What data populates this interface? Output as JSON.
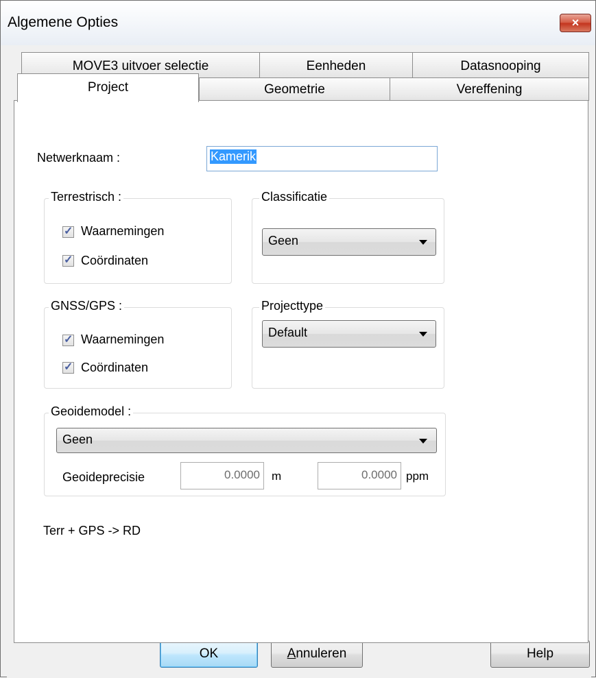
{
  "window": {
    "title": "Algemene Opties",
    "close_glyph": "×",
    "close_icon": "close-icon"
  },
  "tabs": {
    "row1": [
      "MOVE3 uitvoer selectie",
      "Eenheden",
      "Datasnooping"
    ],
    "row2": [
      "Project",
      "Geometrie",
      "Vereffening"
    ],
    "active": "Project"
  },
  "project": {
    "network_name_label": "Netwerknaam :",
    "network_name_value": "Kamerik",
    "terrestrial": {
      "title": "Terrestrisch :",
      "observations": {
        "label": "Waarnemingen",
        "checked": true
      },
      "coordinates": {
        "label": "Coördinaten",
        "checked": true
      }
    },
    "classification": {
      "title": "Classificatie",
      "value": "Geen"
    },
    "gnss": {
      "title": "GNSS/GPS :",
      "observations": {
        "label": "Waarnemingen",
        "checked": true
      },
      "coordinates": {
        "label": "Coördinaten",
        "checked": true
      }
    },
    "project_type": {
      "title": "Projecttype",
      "value": "Default"
    },
    "geoid": {
      "title": "Geoidemodel :",
      "model_value": "Geen",
      "precision_label": "Geoideprecisie",
      "precision_m_value": "0.0000",
      "precision_m_unit": "m",
      "precision_ppm_value": "0.0000",
      "precision_ppm_unit": "ppm"
    },
    "status_text": "Terr + GPS -> RD"
  },
  "buttons": {
    "ok": "OK",
    "cancel_mnemonic": "A",
    "cancel_rest": "nnuleren",
    "help": "Help"
  },
  "colors": {
    "selection": "#3399ff",
    "checkmark": "#4a5fa0",
    "close_button": "#c3341e"
  },
  "icons": {
    "checkbox_check": "check-icon",
    "dropdown": "chevron-down-icon"
  }
}
